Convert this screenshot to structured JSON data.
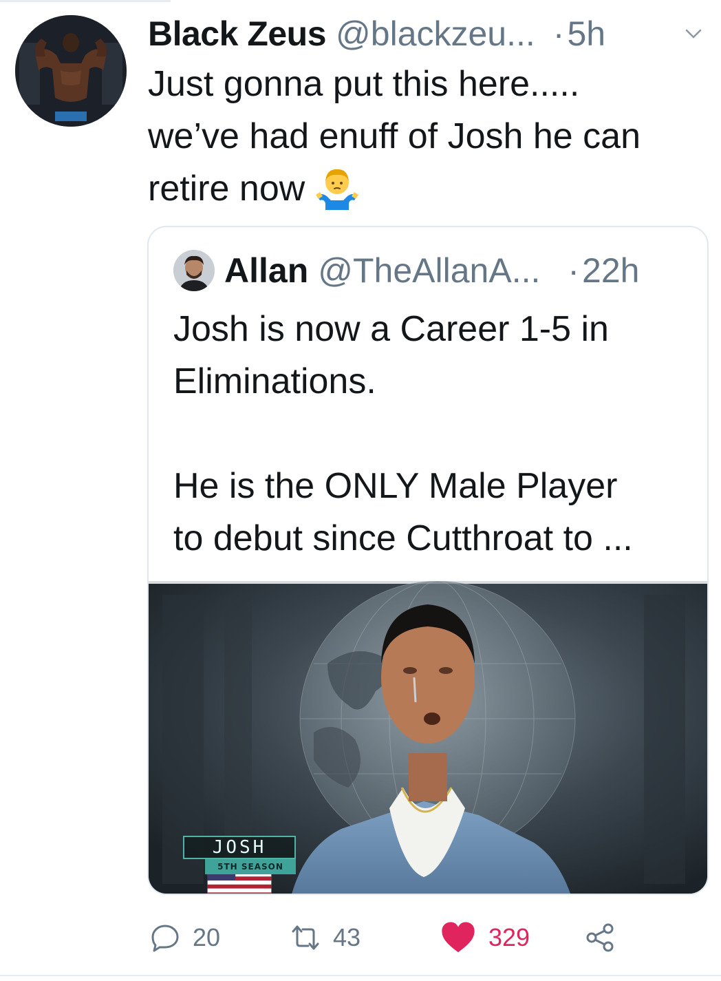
{
  "tweet": {
    "author_name": "Black Zeus",
    "author_handle": "@blackzeu...",
    "separator": "·",
    "time": "5h",
    "text_lines": [
      "Just gonna put this here.....",
      "we’ve had enuff of Josh he can",
      "retire now"
    ],
    "emoji": "man-shrugging-emoji"
  },
  "quoted_tweet": {
    "author_name": "Allan",
    "author_handle": "@TheAllanA...",
    "separator": "·",
    "time": "22h",
    "text_lines": [
      "Josh is now a Career 1-5 in",
      "Eliminations.",
      "",
      "He is the ONLY Male Player",
      "to debut since Cutthroat to ..."
    ],
    "media": {
      "lower_third_name": "JOSH",
      "lower_third_subtitle": "5TH SEASON"
    }
  },
  "actions": {
    "reply_count": "20",
    "retweet_count": "43",
    "like_count": "329",
    "liked": true,
    "like_color": "#e0245e",
    "icon_color": "#657786"
  },
  "icons": [
    "chevron-down-icon",
    "reply-icon",
    "retweet-icon",
    "heart-icon",
    "share-icon"
  ]
}
